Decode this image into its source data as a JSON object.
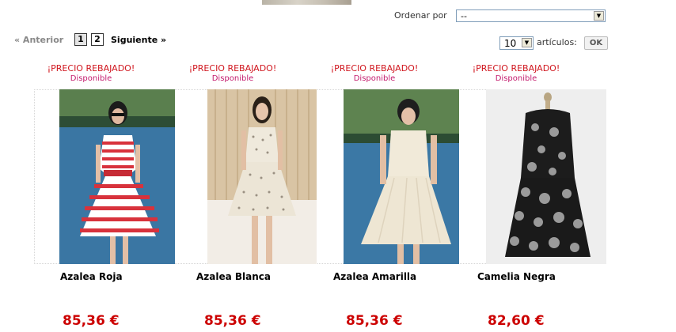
{
  "sort": {
    "label": "Ordenar por",
    "selected": "--"
  },
  "pagination": {
    "prev_label": "« Anterior",
    "pages": [
      "1",
      "2"
    ],
    "current_page": "1",
    "next_label": "Siguiente »"
  },
  "per_page": {
    "selected": "10",
    "label": "artículos:",
    "ok_label": "OK"
  },
  "products": [
    {
      "discount_label": "¡PRECIO REBAJADO!",
      "availability": "Disponible",
      "name": "Azalea Roja",
      "price": "85,36 €",
      "image": "model in red and white striped dress by the lake"
    },
    {
      "discount_label": "¡PRECIO REBAJADO!",
      "availability": "Disponible",
      "name": "Azalea Blanca",
      "price": "85,36 €",
      "image": "model in white polka-dot dress indoors"
    },
    {
      "discount_label": "¡PRECIO REBAJADO!",
      "availability": "Disponible",
      "name": "Azalea Amarilla",
      "price": "85,36 €",
      "image": "model in cream dress by the lake"
    },
    {
      "discount_label": "¡PRECIO REBAJADO!",
      "availability": "Disponible",
      "name": "Camelia Negra",
      "price": "82,60 €",
      "image": "black floral lace dress on mannequin"
    }
  ],
  "colors": {
    "discount": "#d0161e",
    "availability": "#c31b6d",
    "price": "#cc0000"
  }
}
